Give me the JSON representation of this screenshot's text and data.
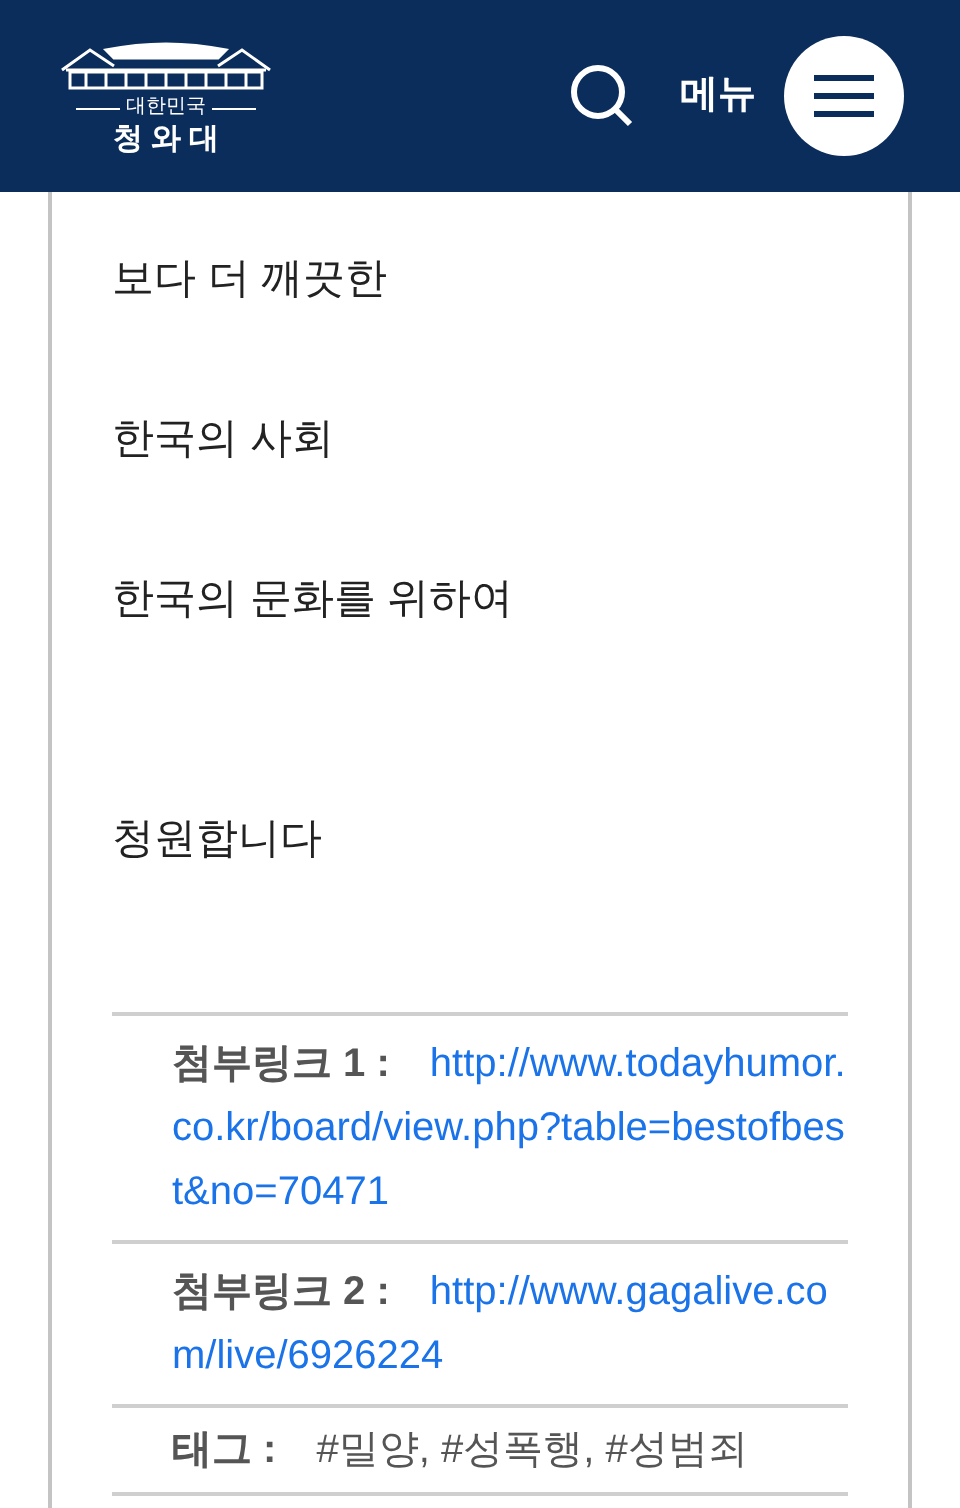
{
  "header": {
    "logo_small": "대한민국",
    "logo_title": "청 와 대",
    "menu_label": "메뉴"
  },
  "body": [
    [
      "보다 더 깨끗한",
      "한국의 사회",
      "한국의 문화를 위하여"
    ],
    [
      "청원합니다"
    ]
  ],
  "attachments": [
    {
      "label": "첨부링크 1 :",
      "link": "http://www.todayhumor.co.kr/board/view.php?table=bestofbest&no=70471"
    },
    {
      "label": "첨부링크 2 :",
      "link": "http://www.gagalive.com/live/6926224"
    }
  ],
  "tags": {
    "label": "태그 :",
    "value": "#밀양, #성폭행, #성범죄"
  }
}
